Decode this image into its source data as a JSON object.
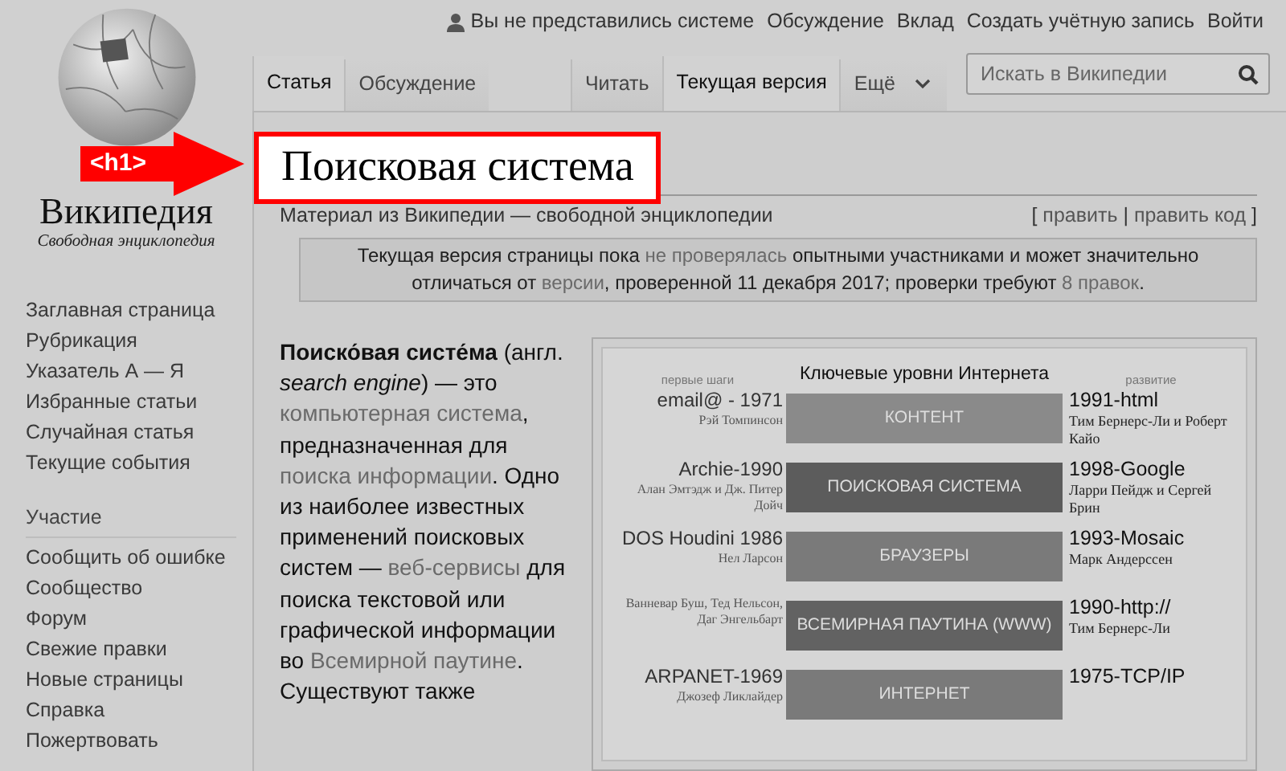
{
  "logo": {
    "wordmark": "Википедия",
    "tagline": "Свободная энциклопедия"
  },
  "personal_links": [
    "Вы не представились системе",
    "Обсуждение",
    "Вклад",
    "Создать учётную запись",
    "Войти"
  ],
  "left_tabs": [
    {
      "label": "Статья",
      "selected": true
    },
    {
      "label": "Обсуждение",
      "selected": false
    }
  ],
  "right_tabs": [
    {
      "label": "Читать",
      "selected": false
    },
    {
      "label": "Текущая версия",
      "selected": true
    },
    {
      "label": "Ещё",
      "selected": false,
      "kind": "menu"
    }
  ],
  "search": {
    "placeholder": "Искать в Википедии"
  },
  "sidebar": {
    "items": [
      "Заглавная страница",
      "Рубрикация",
      "Указатель А — Я",
      "Избранные статьи",
      "Случайная статья",
      "Текущие события"
    ],
    "sections": [
      {
        "heading": "Участие",
        "items": [
          "Сообщить об ошибке",
          "Сообщество",
          "Форум",
          "Свежие правки",
          "Новые страницы",
          "Справка",
          "Пожертвовать"
        ]
      }
    ]
  },
  "annotation": {
    "label": "<h1>"
  },
  "article": {
    "title": "Поисковая система",
    "subtitle": "Материал из Википедии — свободной энциклопедии",
    "edit_links": {
      "open": "[",
      "separator": "|",
      "close": "]",
      "links": [
        "править",
        "править код"
      ]
    },
    "notice": [
      {
        "kind": "text",
        "text": "Текущая версия страницы пока "
      },
      {
        "kind": "link",
        "text": "не проверялась"
      },
      {
        "kind": "text",
        "text": " опытными участниками и может значительно отличаться от "
      },
      {
        "kind": "link",
        "text": "версии"
      },
      {
        "kind": "text",
        "text": ", проверенной 11 декабря 2017; проверки требуют "
      },
      {
        "kind": "link",
        "text": "8 правок"
      },
      {
        "kind": "text",
        "text": "."
      }
    ],
    "paragraph": [
      {
        "kind": "bold",
        "text": "Поиско́вая систе́ма"
      },
      {
        "kind": "text",
        "text": " (англ. "
      },
      {
        "kind": "italic",
        "text": "search engine"
      },
      {
        "kind": "text",
        "text": ") — это "
      },
      {
        "kind": "link",
        "text": "компьютерная система"
      },
      {
        "kind": "text",
        "text": ", предназначенная для "
      },
      {
        "kind": "link",
        "text": "поиска информации"
      },
      {
        "kind": "text",
        "text": ". Одно из наиболее известных применений поисковых систем — "
      },
      {
        "kind": "link",
        "text": "веб-сервисы"
      },
      {
        "kind": "text",
        "text": " для поиска текстовой или графической информации во "
      },
      {
        "kind": "link",
        "text": "Всемирной паутине"
      },
      {
        "kind": "text",
        "text": ". Существуют также"
      }
    ]
  },
  "infographic": {
    "title": "Ключевые уровни Интернета",
    "left_caption": "первые шаги",
    "right_caption": "развитие",
    "rows": [
      {
        "left_title": "email@ - 1971",
        "left_author": "Рэй Томпинсон",
        "bar": "КОНТЕНТ",
        "color": "#8a8a8a",
        "right_title": "1991-html",
        "right_author": "Тим Бернерс-Ли и Роберт Кайо"
      },
      {
        "left_title": "Archie-1990",
        "left_author": "Алан Эмтэдж и Дж. Питер Дойч",
        "bar": "ПОИСКОВАЯ СИСТЕМА",
        "color": "#5c5c5c",
        "right_title": "1998-Google",
        "right_author": "Ларри Пейдж и Сергей Брин"
      },
      {
        "left_title": "DOS Houdini  1986",
        "left_author": "Нел Ларсон",
        "bar": "БРАУЗЕРЫ",
        "color": "#7a7a7a",
        "right_title": "1993-Mosaic",
        "right_author": "Марк Андерссен"
      },
      {
        "left_title": "",
        "left_author": "Ванневар Буш, Тед Нельсон, Даг Энгельбарт",
        "bar": "ВСЕМИРНАЯ ПАУТИНА (WWW)",
        "color": "#626262",
        "right_title": "1990-http://",
        "right_author": "Тим Бернерс-Ли"
      },
      {
        "left_title": "ARPANET-1969",
        "left_author": "Джозеф Ликлайдер",
        "bar": "ИНТЕРНЕТ",
        "color": "#7a7a7a",
        "right_title": "1975-TCP/IP",
        "right_author": ""
      }
    ]
  }
}
